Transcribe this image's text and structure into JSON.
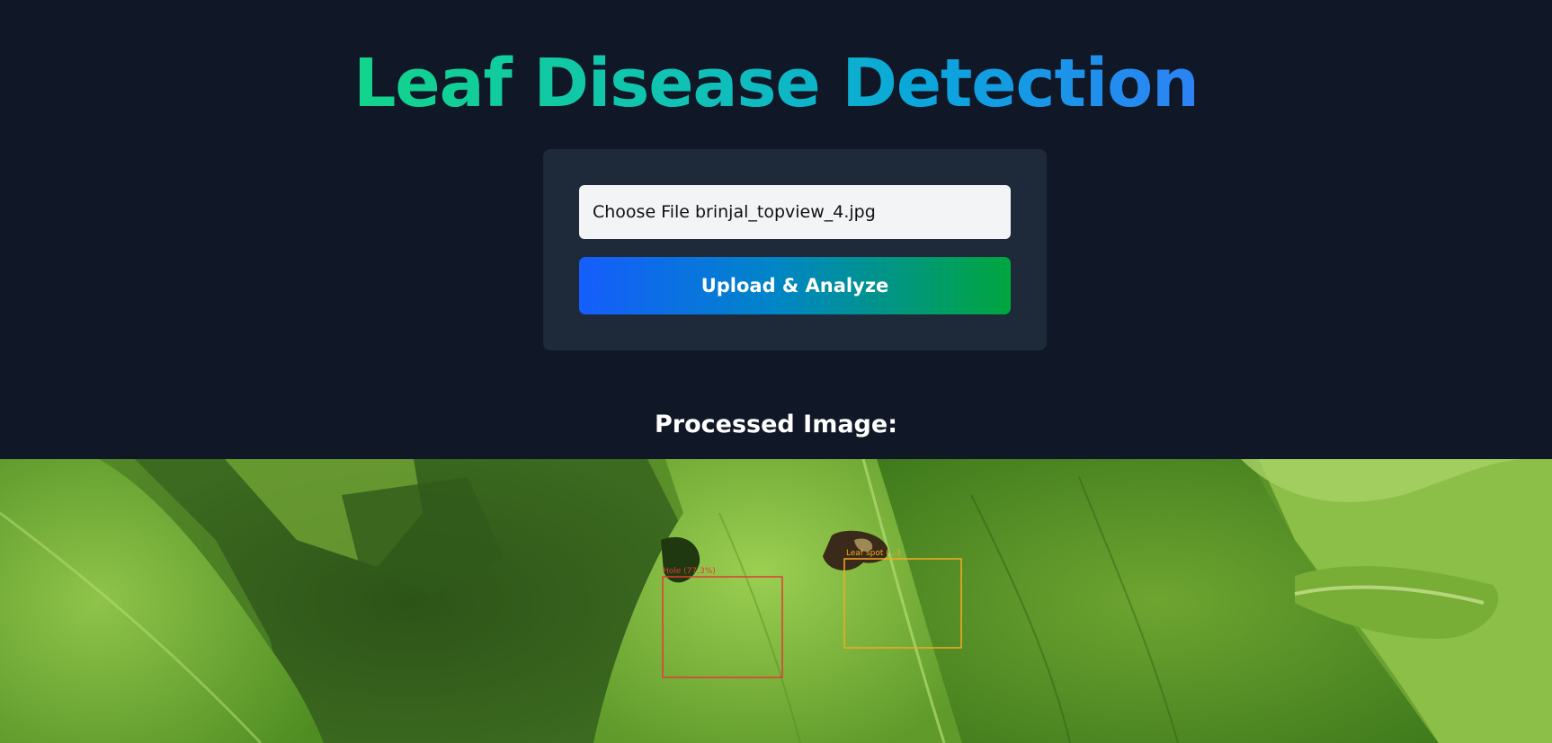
{
  "header": {
    "title": "Leaf Disease Detection"
  },
  "upload_card": {
    "choose_file_label": "Choose File",
    "selected_file": "brinjal_topview_4.jpg",
    "submit_label": "Upload & Analyze"
  },
  "result": {
    "heading": "Processed Image:",
    "detections": [
      {
        "label": "Hole (77.3%)",
        "color": "#e53935"
      },
      {
        "label": "Leaf spot (…)",
        "color": "#f9a825"
      }
    ]
  },
  "colors": {
    "background": "#101828",
    "card": "#1e2939",
    "input": "#f3f4f6",
    "button_start": "#155dfc",
    "button_end": "#00a63e",
    "title_start": "#12d48a",
    "title_end": "#2d82f5"
  }
}
